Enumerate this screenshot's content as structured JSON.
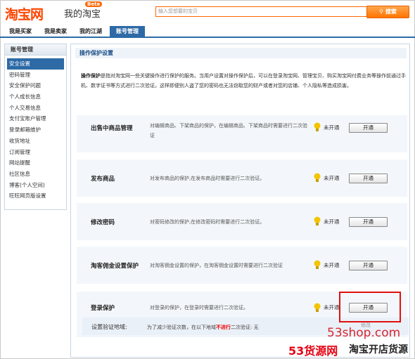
{
  "header": {
    "logo": "淘宝网",
    "logo_sub": "我的淘宝",
    "beta": "Beta",
    "search_placeholder": "输入您想要的宝贝",
    "search_button": "搜索"
  },
  "tabs": [
    {
      "label": "我是买家"
    },
    {
      "label": "我是卖家"
    },
    {
      "label": "我的江湖"
    },
    {
      "label": "账号管理",
      "active": true
    }
  ],
  "sidebar": {
    "title": "账号管理",
    "items": [
      {
        "label": "安全设置",
        "active": true
      },
      {
        "label": "密码管理"
      },
      {
        "label": "安全保护问题"
      },
      {
        "label": "个人成长信息"
      },
      {
        "label": "个人交易信息"
      },
      {
        "label": "支付宝账户管理"
      },
      {
        "label": "登录邮箱维护"
      },
      {
        "label": "收货地址"
      },
      {
        "label": "订阅管理"
      },
      {
        "label": "网站提醒"
      },
      {
        "label": "社区信息"
      },
      {
        "label": "博客(个人空间)"
      },
      {
        "label": "旺旺网页版设置"
      }
    ]
  },
  "main": {
    "title": "操作保护设置",
    "intro_bold": "操作保护",
    "intro_text": "是指对淘宝网一些关键操作进行保护的服务。当用户设置对操作保护后，可以在登录淘宝网、管理宝贝、购买淘宝网付费业务等操作前通过手机、数字证书等方式进行二次验证。这样即便别人盗了您的密码也无法窃取您的财产或者对您的店铺、个人隐私等造成损害。",
    "rows": [
      {
        "name": "出售中商品管理",
        "desc": "对编辑商品、下架商品的保护，在编辑商品、下架商品时需要进行二次验证",
        "status": "未开通",
        "button": "开通"
      },
      {
        "name": "发布商品",
        "desc": "对发布商品的保护,在发布商品时需要进行二次验证。",
        "status": "未开通",
        "button": "开通"
      },
      {
        "name": "修改密码",
        "desc": "对密码修改的保护,在修改密码时需要进行二次验证。",
        "status": "未开通",
        "button": "开通"
      },
      {
        "name": "淘客佣金设置保护",
        "desc": "对淘客佣金设置的保护，在淘客佣金设置时需要进行二次验证",
        "status": "未开通",
        "button": "开通"
      },
      {
        "name": "登录保护",
        "desc": "对登录的保护，在登录时需要进行二次验证。",
        "status": "未开通",
        "button": "开通"
      }
    ],
    "sub": {
      "label": "设置验证地域:",
      "desc_a": "为了减少验证次数，在以下地域",
      "desc_red": "不进行",
      "desc_b": "二次验证: 无",
      "edit": "修改"
    }
  },
  "watermark": {
    "site": "53shop.com",
    "brand": "53货源网",
    "slogan": "淘宝开店货源"
  },
  "colors": {
    "accent": "#2d6aa6",
    "brand": "#ff4400",
    "highlight": "#e01010"
  }
}
